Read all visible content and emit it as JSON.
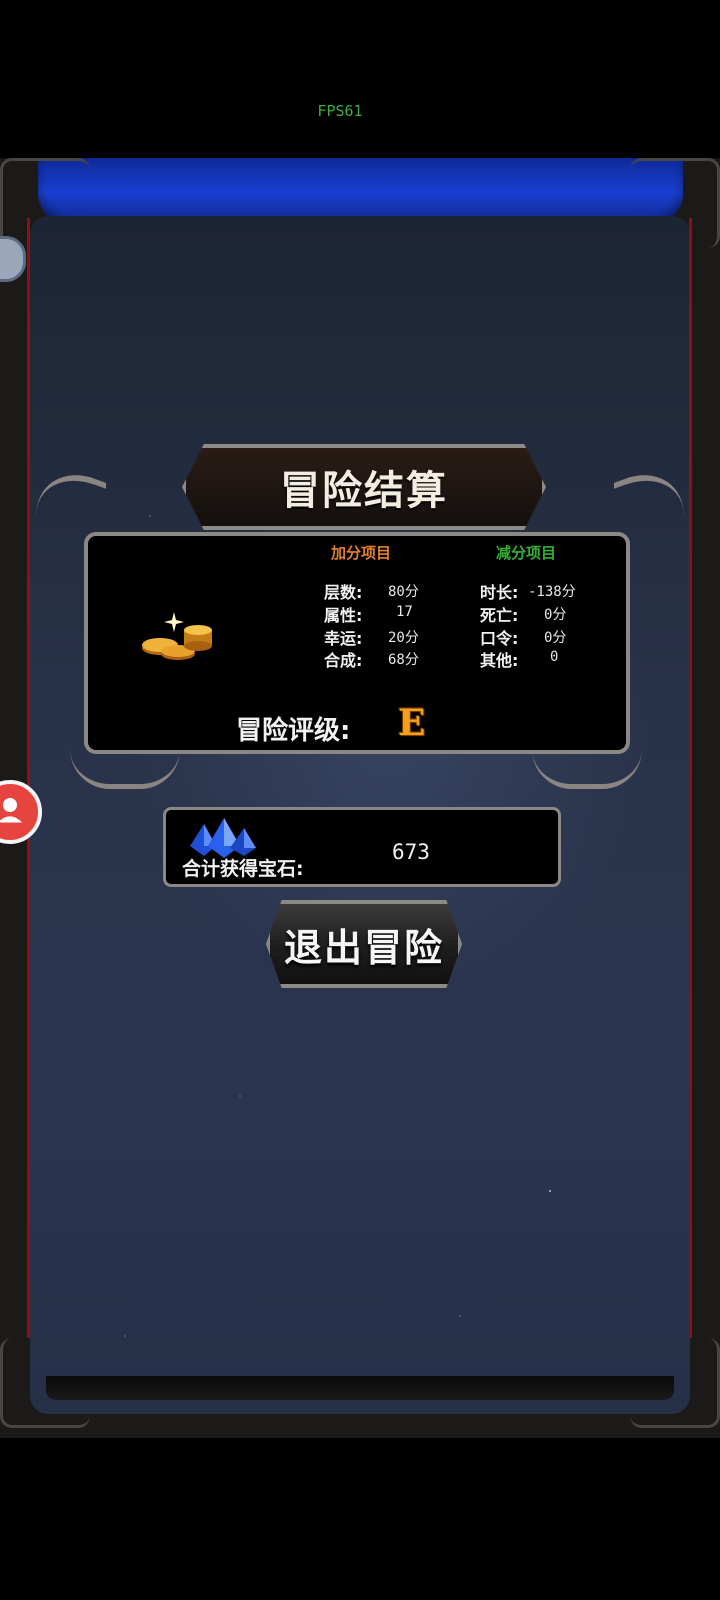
{
  "fps_label": "FPS61",
  "dialog": {
    "title": "冒险结算",
    "plus_header": "加分项目",
    "minus_header": "减分项目",
    "plus_items": [
      {
        "label": "层数:",
        "value": "80分"
      },
      {
        "label": "属性:",
        "value": "17"
      },
      {
        "label": "幸运:",
        "value": "20分"
      },
      {
        "label": "合成:",
        "value": "68分"
      }
    ],
    "minus_items": [
      {
        "label": "时长:",
        "value": "-138分"
      },
      {
        "label": "死亡:",
        "value": "0分"
      },
      {
        "label": "口令:",
        "value": "0分"
      },
      {
        "label": "其他:",
        "value": "0"
      }
    ],
    "rating_label": "冒险评级:",
    "rating_value": "E"
  },
  "gems": {
    "label": "合计获得宝石:",
    "value": "673"
  },
  "exit_button_label": "退出冒险",
  "colors": {
    "plus_header": "#e0812c",
    "minus_header": "#35b035",
    "rating": "#f3a01a",
    "banner": "#1a3fd1",
    "fps": "#3fae3f"
  },
  "icons": [
    "gold-coins-icon",
    "blue-gems-icon",
    "user-avatar-icon",
    "side-handle-icon"
  ]
}
